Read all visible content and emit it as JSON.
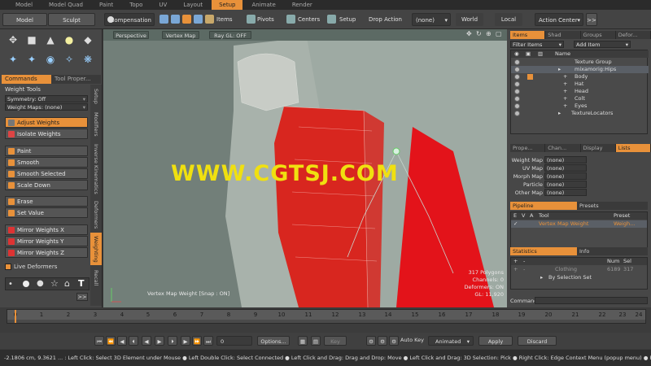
{
  "layout_tabs": [
    "Model",
    "Model Quad",
    "Paint",
    "Topo",
    "UV",
    "Layout",
    "Setup",
    "Animate",
    "Render"
  ],
  "active_layout_tab": "Setup",
  "toolbar": {
    "model": "Model",
    "sculpt": "Sculpt",
    "compensation": "Compensation",
    "items": "Items",
    "pivots": "Pivots",
    "centers": "Centers",
    "setup": "Setup",
    "drop_action_label": "Drop Action",
    "drop_action_value": "(none)",
    "world": "World",
    "local": "Local",
    "action_center": "Action Center",
    "more": ">>"
  },
  "left": {
    "tabs": [
      "Commands",
      "Tool Proper..."
    ],
    "title": "Weight Tools",
    "symmetry": "Symmetry: Off",
    "weight_maps": "Weight Maps: (none)",
    "buttons": [
      "Adjust Weights",
      "Isolate Weights",
      "Paint",
      "Smooth",
      "Smooth Selected",
      "Scale Down",
      "Erase",
      "Set Value",
      "Mirror Weights X",
      "Mirror Weights Y",
      "Mirror Weights Z"
    ],
    "live_deformers": "Live Deformers",
    "vertical_tabs": [
      "Setup",
      "Modifiers",
      "Inverse Kinematics",
      "Deformers",
      "Weighting",
      "Recall"
    ],
    "more": ">>"
  },
  "viewport": {
    "perspective": "Perspective",
    "vertex_map": "Vertex Map",
    "ray_gl": "Ray GL: OFF",
    "status_line": "Vertex Map Weight  [Snap : ON]",
    "info": [
      "317 Polygons",
      "Channels: 0",
      "Deformers: ON",
      "GL: 11,920"
    ],
    "watermark": "WWW.CGTSJ.COM"
  },
  "right": {
    "top_tabs": [
      "Items",
      "Shad",
      "Groups",
      "Defor..."
    ],
    "filter": "Filter Items",
    "add_item": "Add Item",
    "name_header": "Name",
    "items": [
      "Texture Group",
      "mixamorig:Hips",
      "Body",
      "Hat",
      "Head",
      "Colt",
      "Eyes",
      "TextureLocators"
    ],
    "props_tabs": [
      "Prope...",
      "Chan...",
      "Display",
      "Lists"
    ],
    "props": [
      {
        "label": "Weight Map",
        "value": "(none)"
      },
      {
        "label": "UV Map",
        "value": "(none)"
      },
      {
        "label": "Morph Map",
        "value": "(none)"
      },
      {
        "label": "Particle",
        "value": "(none)"
      },
      {
        "label": "Other Map",
        "value": "(none)"
      }
    ],
    "pipeline": "Pipeline",
    "presets": "Presets",
    "pipe_headers": [
      "E",
      "V",
      "A",
      "Tool",
      "Preset"
    ],
    "pipe_row": {
      "tool": "Vertex Map Weight",
      "preset": "Weigh..."
    },
    "statistics": "Statistics",
    "info": "Info",
    "stats_headers": [
      "Num",
      "Sel"
    ],
    "stats_rows": [
      {
        "name": "Clothing",
        "num": "6189",
        "sel": "317"
      },
      {
        "name": "By Selection Set",
        "num": "",
        "sel": ""
      }
    ],
    "command": "Command"
  },
  "timeline": {
    "ticks": [
      "0",
      "2",
      "4",
      "6",
      "8",
      "10",
      "12",
      "14",
      "16",
      "18",
      "20",
      "22",
      "24"
    ],
    "minor": [
      "1",
      "3",
      "5",
      "7",
      "9",
      "11",
      "13",
      "15",
      "17",
      "19",
      "21",
      "23"
    ]
  },
  "bottom": {
    "frame": "0",
    "options": "Options...",
    "key": "Key",
    "auto_key": "Auto Key",
    "animated": "Animated",
    "apply": "Apply",
    "discard": "Discard"
  },
  "status": "-2.1806 cm, 9.3621 ... : Left Click: Select 3D Element under Mouse ● Left Double Click: Select Connected ● Left Click and Drag: Drag and Drop: Move ● Left Click and Drag: 3D Selection: Pick ● Right Click: Edge Context Menu (popup menu) ● Right Click and ..."
}
